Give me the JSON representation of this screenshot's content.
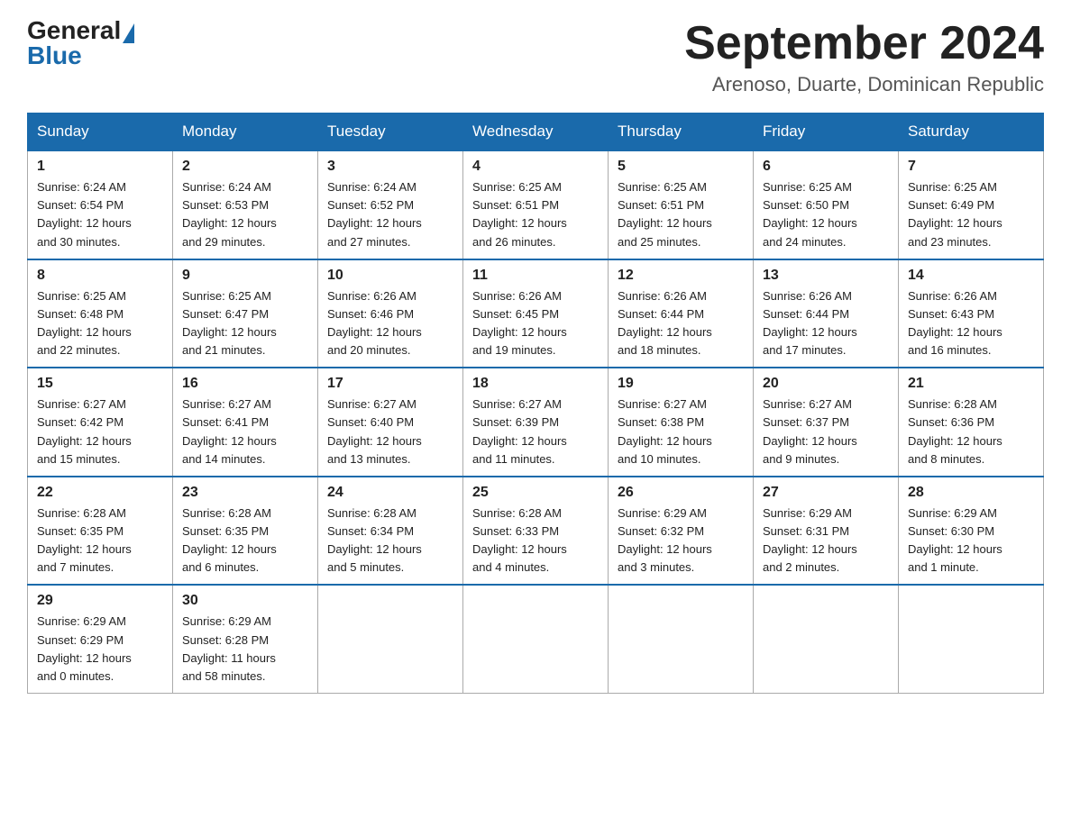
{
  "logo": {
    "general": "General",
    "blue": "Blue"
  },
  "header": {
    "month": "September 2024",
    "location": "Arenoso, Duarte, Dominican Republic"
  },
  "days_of_week": [
    "Sunday",
    "Monday",
    "Tuesday",
    "Wednesday",
    "Thursday",
    "Friday",
    "Saturday"
  ],
  "weeks": [
    [
      {
        "day": "1",
        "sunrise": "6:24 AM",
        "sunset": "6:54 PM",
        "daylight": "12 hours and 30 minutes."
      },
      {
        "day": "2",
        "sunrise": "6:24 AM",
        "sunset": "6:53 PM",
        "daylight": "12 hours and 29 minutes."
      },
      {
        "day": "3",
        "sunrise": "6:24 AM",
        "sunset": "6:52 PM",
        "daylight": "12 hours and 27 minutes."
      },
      {
        "day": "4",
        "sunrise": "6:25 AM",
        "sunset": "6:51 PM",
        "daylight": "12 hours and 26 minutes."
      },
      {
        "day": "5",
        "sunrise": "6:25 AM",
        "sunset": "6:51 PM",
        "daylight": "12 hours and 25 minutes."
      },
      {
        "day": "6",
        "sunrise": "6:25 AM",
        "sunset": "6:50 PM",
        "daylight": "12 hours and 24 minutes."
      },
      {
        "day": "7",
        "sunrise": "6:25 AM",
        "sunset": "6:49 PM",
        "daylight": "12 hours and 23 minutes."
      }
    ],
    [
      {
        "day": "8",
        "sunrise": "6:25 AM",
        "sunset": "6:48 PM",
        "daylight": "12 hours and 22 minutes."
      },
      {
        "day": "9",
        "sunrise": "6:25 AM",
        "sunset": "6:47 PM",
        "daylight": "12 hours and 21 minutes."
      },
      {
        "day": "10",
        "sunrise": "6:26 AM",
        "sunset": "6:46 PM",
        "daylight": "12 hours and 20 minutes."
      },
      {
        "day": "11",
        "sunrise": "6:26 AM",
        "sunset": "6:45 PM",
        "daylight": "12 hours and 19 minutes."
      },
      {
        "day": "12",
        "sunrise": "6:26 AM",
        "sunset": "6:44 PM",
        "daylight": "12 hours and 18 minutes."
      },
      {
        "day": "13",
        "sunrise": "6:26 AM",
        "sunset": "6:44 PM",
        "daylight": "12 hours and 17 minutes."
      },
      {
        "day": "14",
        "sunrise": "6:26 AM",
        "sunset": "6:43 PM",
        "daylight": "12 hours and 16 minutes."
      }
    ],
    [
      {
        "day": "15",
        "sunrise": "6:27 AM",
        "sunset": "6:42 PM",
        "daylight": "12 hours and 15 minutes."
      },
      {
        "day": "16",
        "sunrise": "6:27 AM",
        "sunset": "6:41 PM",
        "daylight": "12 hours and 14 minutes."
      },
      {
        "day": "17",
        "sunrise": "6:27 AM",
        "sunset": "6:40 PM",
        "daylight": "12 hours and 13 minutes."
      },
      {
        "day": "18",
        "sunrise": "6:27 AM",
        "sunset": "6:39 PM",
        "daylight": "12 hours and 11 minutes."
      },
      {
        "day": "19",
        "sunrise": "6:27 AM",
        "sunset": "6:38 PM",
        "daylight": "12 hours and 10 minutes."
      },
      {
        "day": "20",
        "sunrise": "6:27 AM",
        "sunset": "6:37 PM",
        "daylight": "12 hours and 9 minutes."
      },
      {
        "day": "21",
        "sunrise": "6:28 AM",
        "sunset": "6:36 PM",
        "daylight": "12 hours and 8 minutes."
      }
    ],
    [
      {
        "day": "22",
        "sunrise": "6:28 AM",
        "sunset": "6:35 PM",
        "daylight": "12 hours and 7 minutes."
      },
      {
        "day": "23",
        "sunrise": "6:28 AM",
        "sunset": "6:35 PM",
        "daylight": "12 hours and 6 minutes."
      },
      {
        "day": "24",
        "sunrise": "6:28 AM",
        "sunset": "6:34 PM",
        "daylight": "12 hours and 5 minutes."
      },
      {
        "day": "25",
        "sunrise": "6:28 AM",
        "sunset": "6:33 PM",
        "daylight": "12 hours and 4 minutes."
      },
      {
        "day": "26",
        "sunrise": "6:29 AM",
        "sunset": "6:32 PM",
        "daylight": "12 hours and 3 minutes."
      },
      {
        "day": "27",
        "sunrise": "6:29 AM",
        "sunset": "6:31 PM",
        "daylight": "12 hours and 2 minutes."
      },
      {
        "day": "28",
        "sunrise": "6:29 AM",
        "sunset": "6:30 PM",
        "daylight": "12 hours and 1 minute."
      }
    ],
    [
      {
        "day": "29",
        "sunrise": "6:29 AM",
        "sunset": "6:29 PM",
        "daylight": "12 hours and 0 minutes."
      },
      {
        "day": "30",
        "sunrise": "6:29 AM",
        "sunset": "6:28 PM",
        "daylight": "11 hours and 58 minutes."
      },
      null,
      null,
      null,
      null,
      null
    ]
  ]
}
